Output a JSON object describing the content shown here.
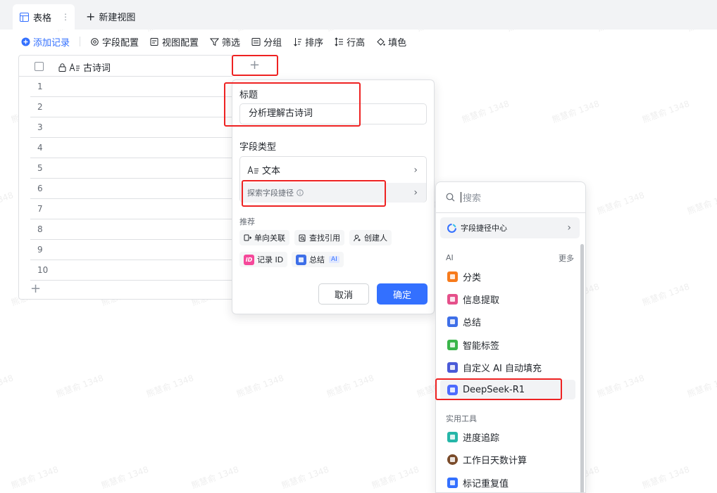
{
  "tabs": {
    "active": "表格",
    "new_view": "新建视图"
  },
  "toolbar": {
    "add_record": "添加记录",
    "field_config": "字段配置",
    "view_config": "视图配置",
    "filter": "筛选",
    "group": "分组",
    "sort": "排序",
    "row_height": "行高",
    "fill_color": "填色"
  },
  "grid": {
    "column_header": "古诗词",
    "row_numbers": [
      "1",
      "2",
      "3",
      "4",
      "5",
      "6",
      "7",
      "8",
      "9",
      "10"
    ],
    "add_symbol": "+"
  },
  "field_panel": {
    "title_label": "标题",
    "title_value": "分析理解古诗词",
    "type_label": "字段类型",
    "type_value": "文本",
    "explore_shortcut": "探索字段捷径",
    "recommend_label": "推荐",
    "recommend_chips": [
      "单向关联",
      "查找引用",
      "创建人",
      "记录 ID",
      "总结"
    ],
    "ai_badge": "AI",
    "cancel": "取消",
    "confirm": "确定"
  },
  "shortcut_menu": {
    "search_placeholder": "搜索",
    "center": "字段捷径中心",
    "ai_section": "AI",
    "more": "更多",
    "ai_items": [
      {
        "label": "分类",
        "color": "#f77b1c"
      },
      {
        "label": "信息提取",
        "color": "#e5508a"
      },
      {
        "label": "总结",
        "color": "#3e6fe8"
      },
      {
        "label": "智能标签",
        "color": "#3ab54a"
      },
      {
        "label": "自定义 AI 自动填充",
        "color": "#4a5ad8"
      },
      {
        "label": "DeepSeek-R1",
        "color": "#4d6bfe"
      }
    ],
    "tools_section": "实用工具",
    "tool_items": [
      {
        "label": "进度追踪",
        "color": "#25b6a8"
      },
      {
        "label": "工作日天数计算",
        "color": "#7a4b2a"
      },
      {
        "label": "标记重复值",
        "color": "#3370ff"
      }
    ]
  },
  "watermark": "熊慧俞 1348",
  "colors": {
    "accent": "#3370ff",
    "annotation": "#ee2222"
  }
}
